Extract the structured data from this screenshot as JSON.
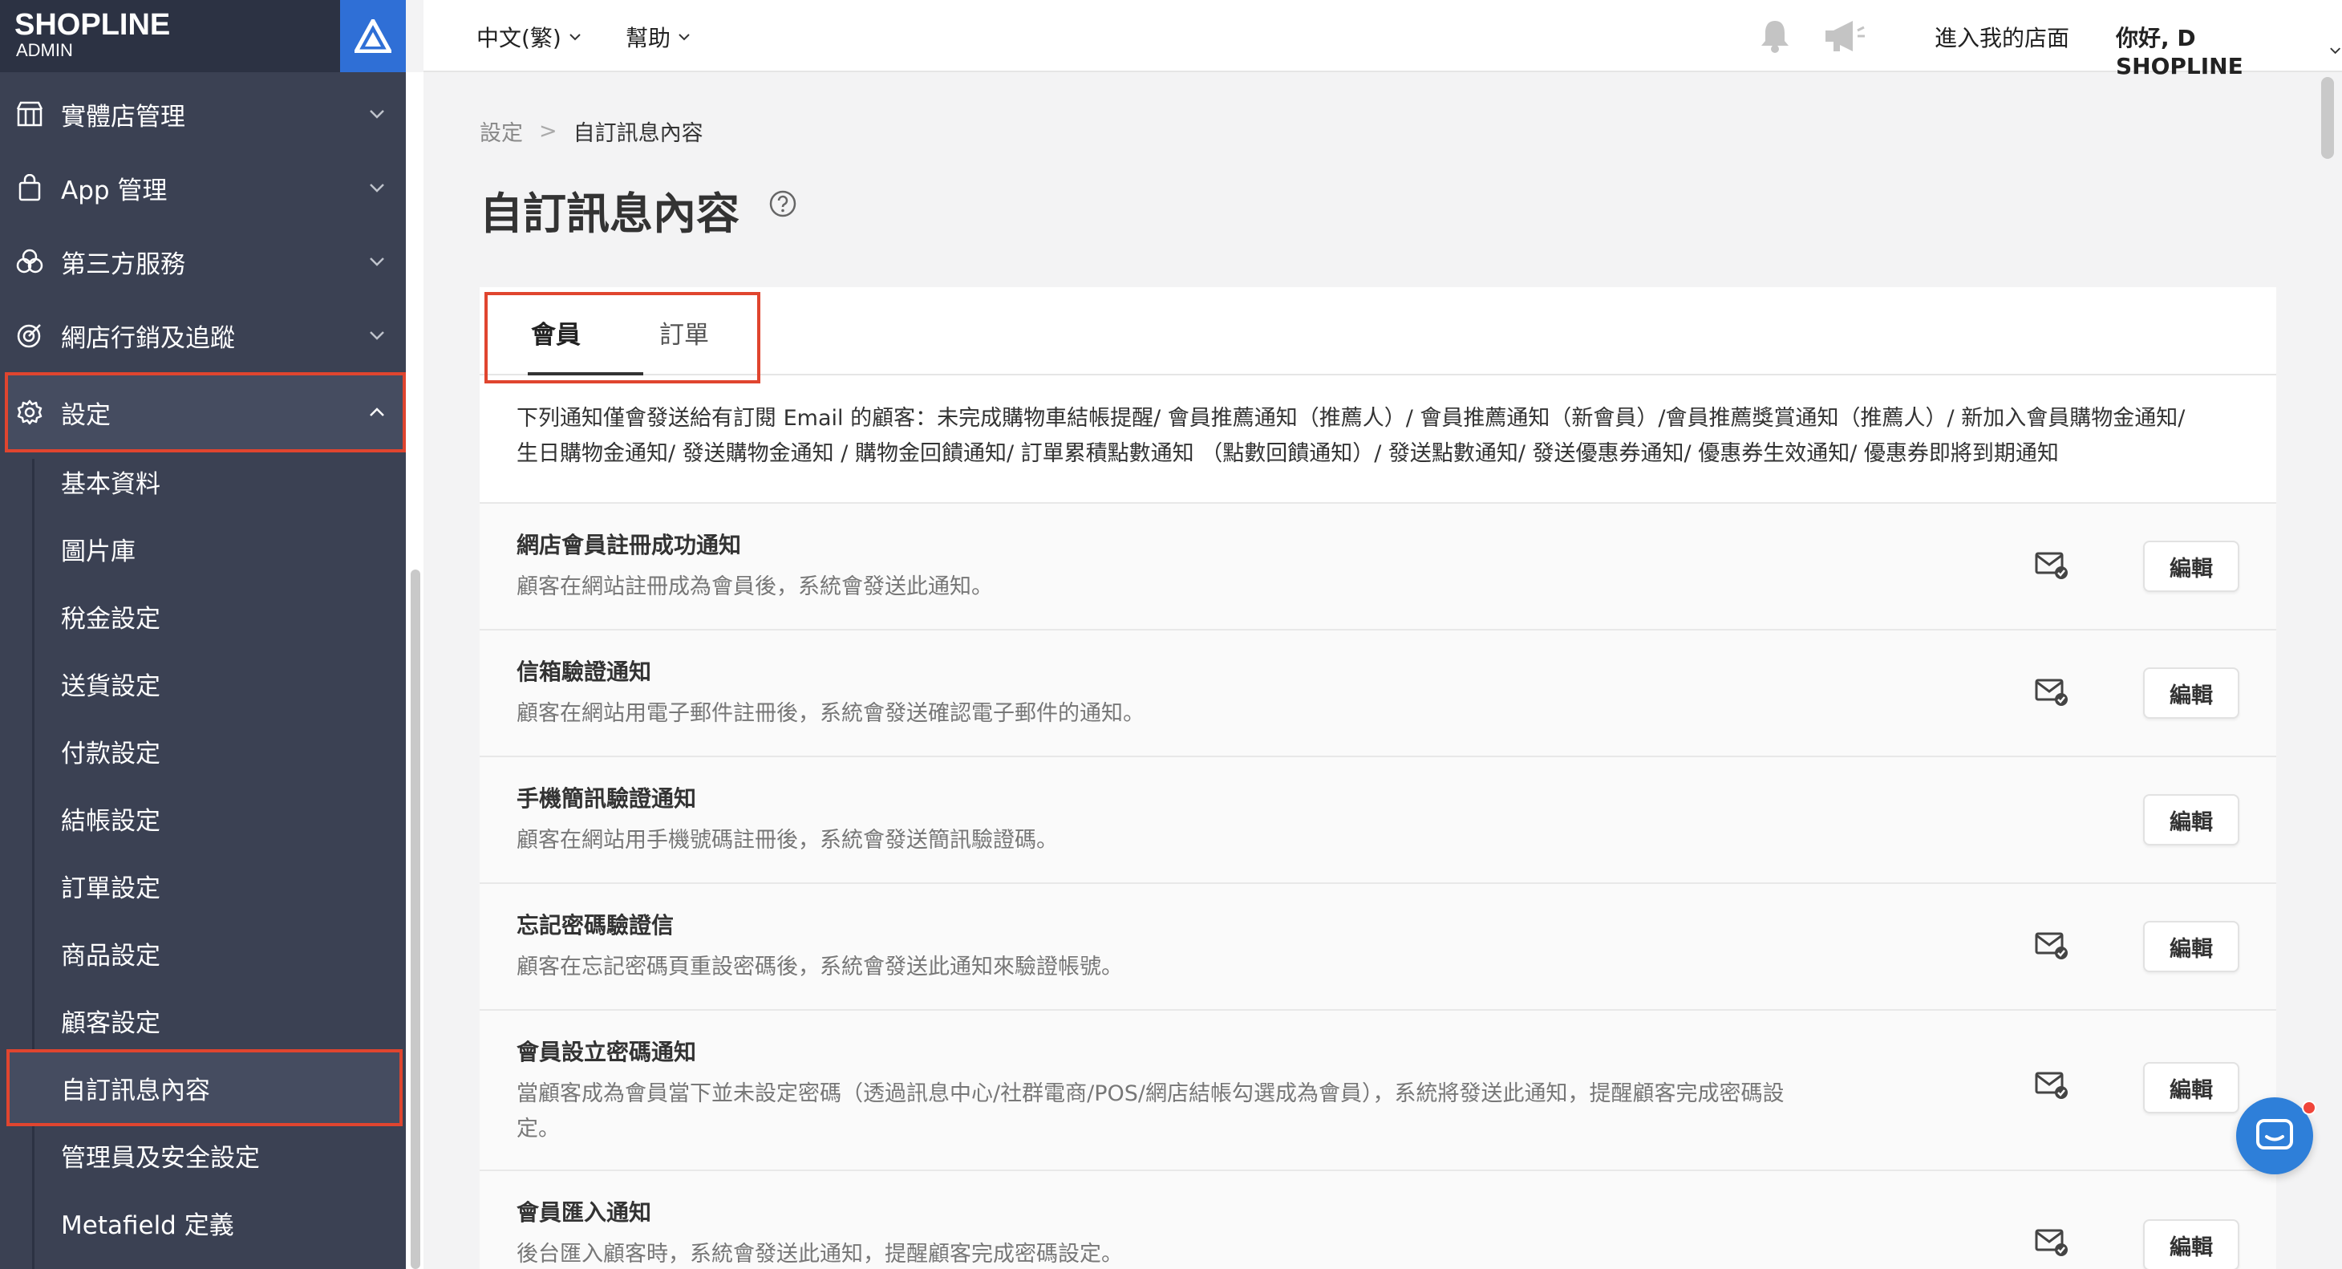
{
  "sidebar": {
    "logo": "SHOPLINE",
    "logo_sub": "ADMIN",
    "items": [
      {
        "label": "實體店管理",
        "icon": "store-icon"
      },
      {
        "label": "App 管理",
        "icon": "shopping-bag-icon"
      },
      {
        "label": "第三方服務",
        "icon": "circles-icon"
      },
      {
        "label": "網店行銷及追蹤",
        "icon": "target-icon"
      },
      {
        "label": "設定",
        "icon": "gear-icon"
      }
    ],
    "sub_items": [
      "基本資料",
      "圖片庫",
      "稅金設定",
      "送貨設定",
      "付款設定",
      "結帳設定",
      "訂單設定",
      "商品設定",
      "顧客設定",
      "自訂訊息內容",
      "管理員及安全設定",
      "Metafield 定義"
    ]
  },
  "topbar": {
    "language": "中文(繁)",
    "help": "幫助",
    "store_link": "進入我的店面",
    "greeting": "你好, D SHOPLINE"
  },
  "breadcrumb": {
    "parent": "設定",
    "sep": ">",
    "current": "自訂訊息內容"
  },
  "page_title": "自訂訊息內容",
  "tabs": [
    "會員",
    "訂單"
  ],
  "notice_line1": "下列通知僅會發送給有訂閱 Email 的顧客：未完成購物車結帳提醒/ 會員推薦通知（推薦人）/ 會員推薦通知（新會員）/會員推薦獎賞通知（推薦人）/ 新加入會員購物金通知/",
  "notice_line2": "生日購物金通知/ 發送購物金通知 / 購物金回饋通知/ 訂單累積點數通知 （點數回饋通知）/ 發送點數通知/ 發送優惠券通知/ 優惠券生效通知/ 優惠券即將到期通知",
  "edit_label": "編輯",
  "rows": [
    {
      "title": "網店會員註冊成功通知",
      "desc": "顧客在網站註冊成為會員後，系統會發送此通知。",
      "email": true,
      "sms": "disabled"
    },
    {
      "title": "信箱驗證通知",
      "desc": "顧客在網站用電子郵件註冊後，系統會發送確認電子郵件的通知。",
      "email": true,
      "sms": "none"
    },
    {
      "title": "手機簡訊驗證通知",
      "desc": "顧客在網站用手機號碼註冊後，系統會發送簡訊驗證碼。",
      "email": false,
      "sms": "on"
    },
    {
      "title": "忘記密碼驗證信",
      "desc": "顧客在忘記密碼頁重設密碼後，系統會發送此通知來驗證帳號。",
      "email": true,
      "sms": "none"
    },
    {
      "title": "會員設立密碼通知",
      "desc": "當顧客成為會員當下並未設定密碼（透過訊息中心/社群電商/POS/網店結帳勾選成為會員），系統將發送此通知，提醒顧客完成密碼設定。",
      "email": true,
      "sms": "on"
    },
    {
      "title": "會員匯入通知",
      "desc": "後台匯入顧客時，系統會發送此通知，提醒顧客完成密碼設定。",
      "email": true,
      "sms": "on"
    }
  ],
  "colors": {
    "sidebar": "#3b4153",
    "highlight": "#e0452f",
    "accent": "#2e7fd9"
  }
}
